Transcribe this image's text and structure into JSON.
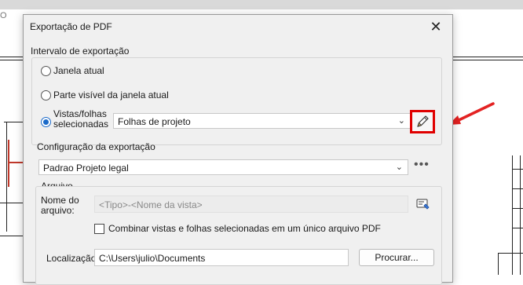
{
  "dialog": {
    "title": "Exportação de PDF",
    "close_glyph": "✕"
  },
  "background": {
    "fragment_text": "O"
  },
  "range": {
    "legend": "Intervalo de exportação",
    "options": [
      {
        "label": "Janela atual",
        "selected": false
      },
      {
        "label": "Parte visível da janela atual",
        "selected": false
      },
      {
        "label_line1": "Vistas/folhas",
        "label_line2": "selecionadas",
        "selected": true
      }
    ],
    "selection_value": "Folhas de projeto",
    "edit_icon": "pencil-icon"
  },
  "config": {
    "legend": "Configuração da exportação",
    "value": "Padrao Projeto legal",
    "more_glyph": "•••"
  },
  "file": {
    "legend": "Arquivo",
    "name_label_line1": "Nome do",
    "name_label_line2": "arquivo:",
    "name_placeholder": "<Tipo>-<Nome da vista>",
    "combine_label": "Combinar vistas e folhas selecionadas em um único arquivo PDF",
    "combine_checked": false,
    "location_label": "Localização:",
    "location_value": "C:\\Users\\julio\\Documents",
    "browse_label": "Procurar..."
  },
  "colors": {
    "accent": "#1b6ac9",
    "highlight": "#e00000",
    "arrow": "#e32222"
  }
}
